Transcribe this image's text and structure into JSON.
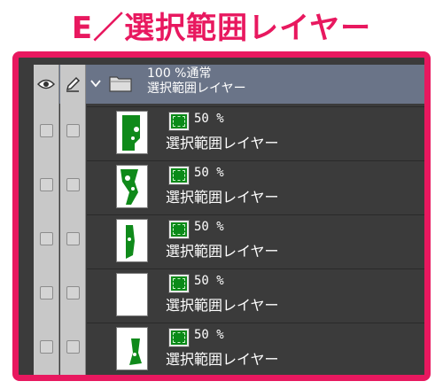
{
  "title": "E／選択範囲レイヤー",
  "colors": {
    "title": "#e8185f",
    "frame": "#e8185f",
    "panel_bg": "#3b3b3b",
    "header_bg": "#6a7488",
    "mask_green": "#0a8a18"
  },
  "folder": {
    "opacity_blend": "100 %通常",
    "name": "選択範囲レイヤー",
    "icons": [
      "eye-icon",
      "pen-icon",
      "chevron-down-icon",
      "folder-icon"
    ]
  },
  "layers": [
    {
      "opacity": "50 %",
      "name": "選択範囲レイヤー"
    },
    {
      "opacity": "50 %",
      "name": "選択範囲レイヤー"
    },
    {
      "opacity": "50 %",
      "name": "選択範囲レイヤー"
    },
    {
      "opacity": "50 %",
      "name": "選択範囲レイヤー"
    },
    {
      "opacity": "50 %",
      "name": "選択範囲レイヤー"
    }
  ]
}
